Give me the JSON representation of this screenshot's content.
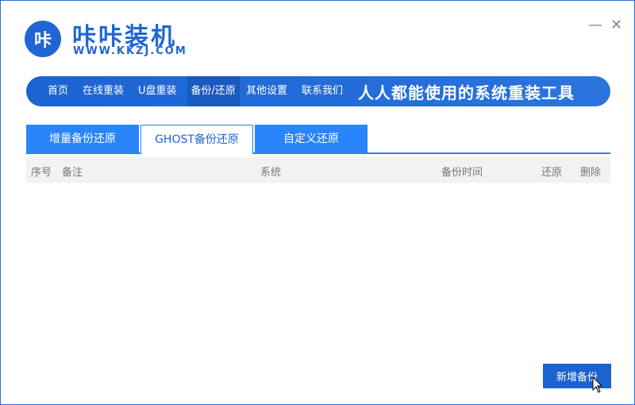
{
  "app": {
    "logo_text": "咔",
    "name": "咔咔装机",
    "url": "WWW.KKZJ.COM"
  },
  "window": {
    "minimize": "—",
    "close": "✕"
  },
  "nav": {
    "items": [
      "首页",
      "在线重装",
      "U盘重装",
      "备份/还原",
      "其他设置",
      "联系我们"
    ],
    "active": 3,
    "slogan": "人人都能使用的系统重装工具"
  },
  "tabs": {
    "items": [
      "增量备份还原",
      "GHOST备份还原",
      "自定义还原"
    ],
    "active": 1
  },
  "table": {
    "headers": [
      "序号",
      "备注",
      "系统",
      "备份时间",
      "还原",
      "删除"
    ]
  },
  "actions": {
    "add_backup": "新增备份"
  },
  "colors": {
    "primary": "#1f66d4",
    "tab": "#2a85fb"
  }
}
